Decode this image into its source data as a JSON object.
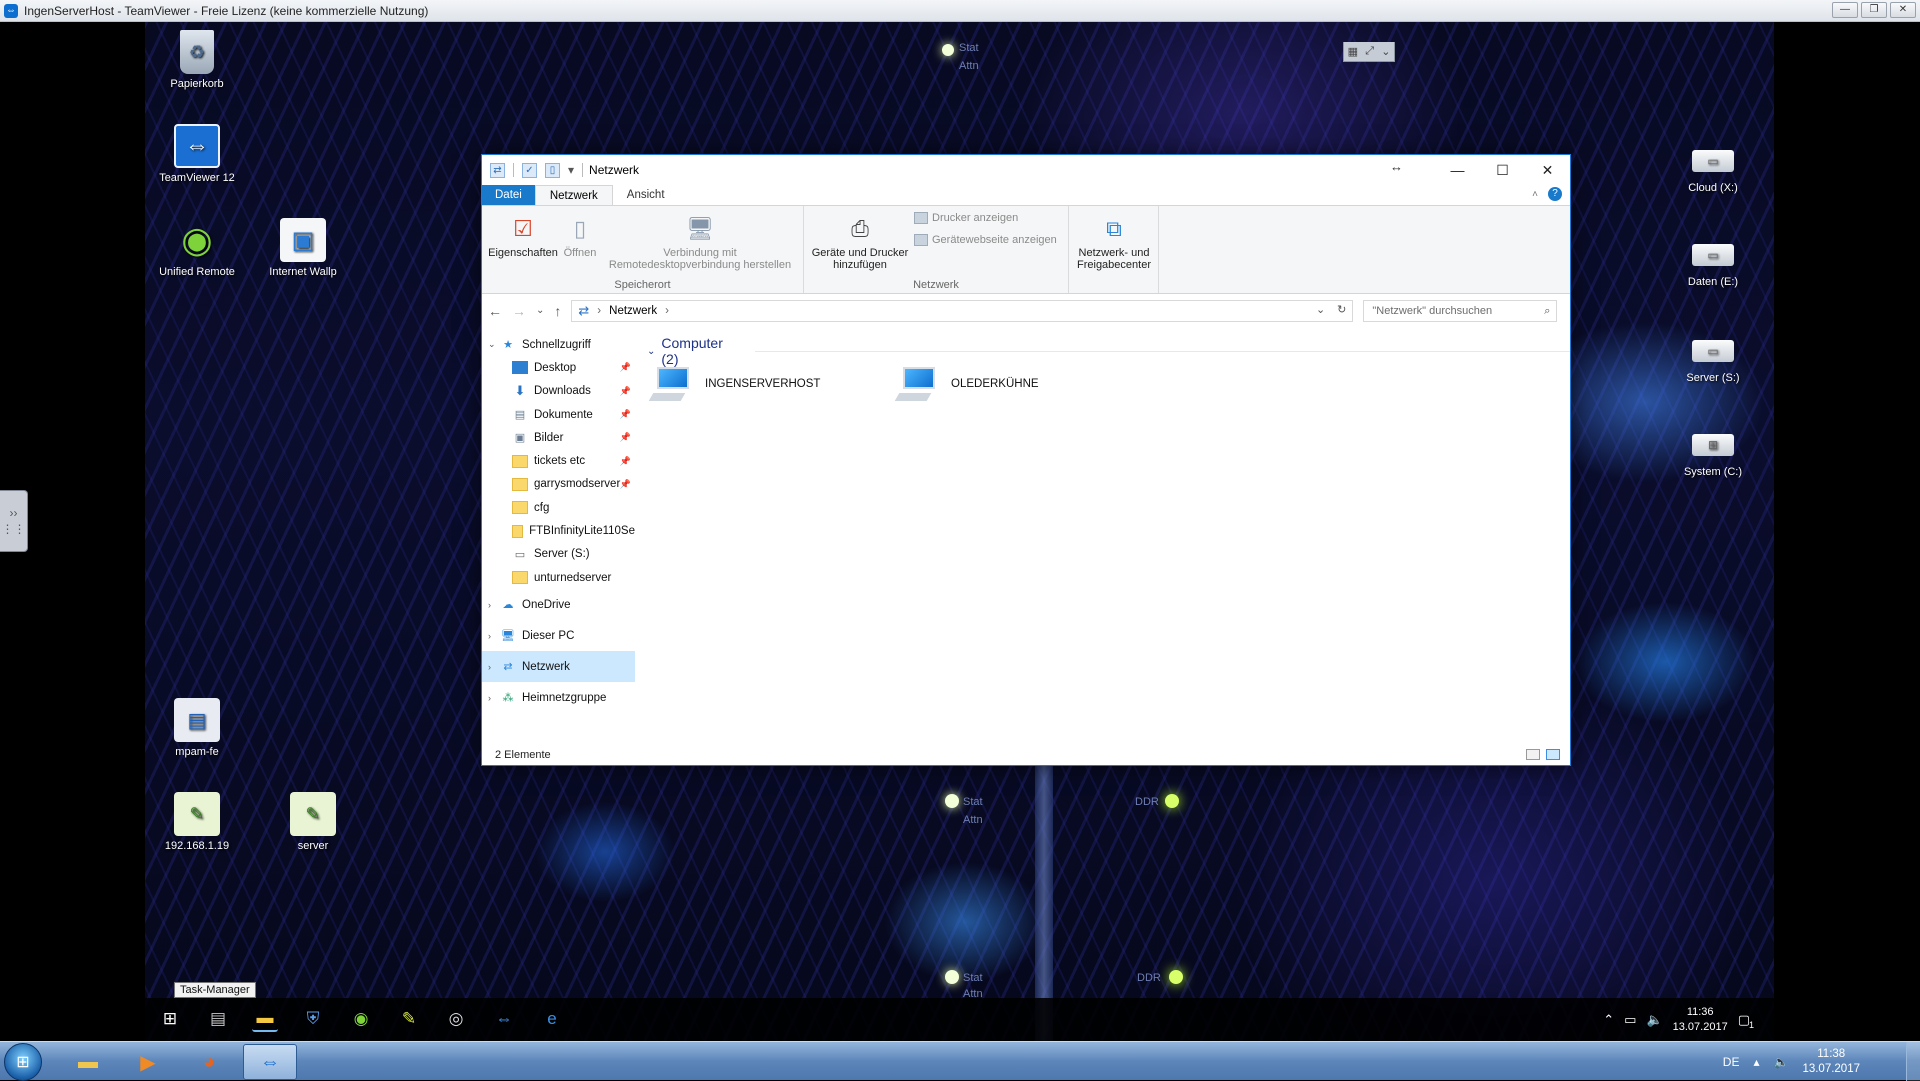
{
  "teamviewer": {
    "title": "IngenServerHost - TeamViewer - Freie Lizenz (keine kommerzielle Nutzung)",
    "controls": [
      "—",
      "❐",
      "✕"
    ]
  },
  "wallpaper_labels": [
    "Stat",
    "Attn",
    "Stat",
    "Attn",
    "DDR",
    "Stat",
    "Attn",
    "DDR"
  ],
  "desktop_left": [
    {
      "label": "Papierkorb",
      "icon": "recycle-bin-icon"
    },
    {
      "label": "TeamViewer 12",
      "icon": "teamviewer-icon"
    },
    {
      "label": "Unified Remote",
      "icon": "unified-remote-icon"
    },
    {
      "label": "Internet Wallp",
      "icon": "image-file-icon"
    },
    {
      "label": "mpam-fe",
      "icon": "installer-icon"
    },
    {
      "label": "192.168.1.19",
      "icon": "script-file-icon"
    },
    {
      "label": "server",
      "icon": "script-file-icon"
    }
  ],
  "desktop_right": [
    {
      "label": "Cloud (X:)",
      "icon": "network-drive-icon"
    },
    {
      "label": "Daten (E:)",
      "icon": "network-drive-icon"
    },
    {
      "label": "Server (S:)",
      "icon": "network-drive-icon"
    },
    {
      "label": "System (C:)",
      "icon": "system-drive-icon"
    }
  ],
  "explorer": {
    "title": "Netzwerk",
    "tabs": {
      "file": "Datei",
      "network": "Netzwerk",
      "view": "Ansicht"
    },
    "ribbon": {
      "properties": "Eigenschaften",
      "open": "Öffnen",
      "rdp_line1": "Verbindung mit",
      "rdp_line2": "Remotedesktopverbindung herstellen",
      "group_location": "Speicherort",
      "add_devices_line1": "Geräte und Drucker",
      "add_devices_line2": "hinzufügen",
      "show_printers": "Drucker anzeigen",
      "show_device_webpage": "Gerätewebseite anzeigen",
      "group_network": "Netzwerk",
      "sharing_center_line1": "Netzwerk- und",
      "sharing_center_line2": "Freigabecenter"
    },
    "address": {
      "path": "Netzwerk",
      "search_placeholder": "\"Netzwerk\" durchsuchen"
    },
    "nav": {
      "quick_access": "Schnellzugriff",
      "quick_items": [
        {
          "label": "Desktop",
          "pinned": true
        },
        {
          "label": "Downloads",
          "pinned": true
        },
        {
          "label": "Dokumente",
          "pinned": true
        },
        {
          "label": "Bilder",
          "pinned": true
        },
        {
          "label": "tickets etc",
          "pinned": true
        },
        {
          "label": "garrysmodserver",
          "pinned": true
        },
        {
          "label": "cfg",
          "pinned": false
        },
        {
          "label": "FTBInfinityLite110Se",
          "pinned": false
        },
        {
          "label": "Server (S:)",
          "pinned": false
        },
        {
          "label": "unturnedserver",
          "pinned": false
        }
      ],
      "onedrive": "OneDrive",
      "this_pc": "Dieser PC",
      "network": "Netzwerk",
      "homegroup": "Heimnetzgruppe"
    },
    "group_header": "Computer (2)",
    "computers": [
      "INGENSERVERHOST",
      "OLEDERKÜHNE"
    ],
    "status": "2 Elemente"
  },
  "remote_taskbar": {
    "tooltip": "Task-Manager",
    "tray_time": "11:36",
    "tray_date": "13.07.2017",
    "notification_count": "1"
  },
  "local_taskbar": {
    "lang": "DE",
    "time": "11:38",
    "date": "13.07.2017"
  },
  "colors": {
    "accent": "#1979ca",
    "selection": "#cce8ff",
    "group_header": "#1e3287"
  }
}
